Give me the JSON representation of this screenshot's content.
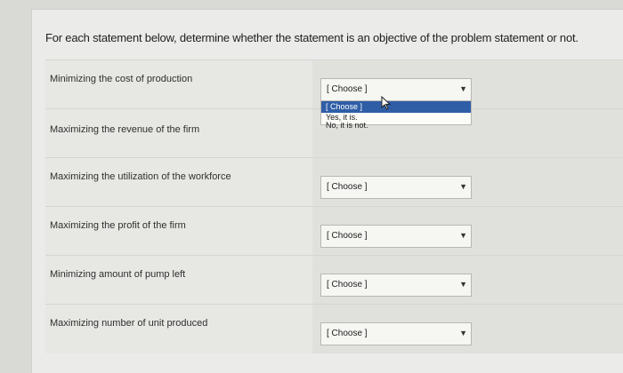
{
  "prompt": "For each statement below, determine whether the statement is an objective of the problem statement or not.",
  "rows": [
    {
      "statement": "Minimizing the cost of production",
      "select_value": "[ Choose ]"
    },
    {
      "statement": "Maximizing the revenue of the firm",
      "select_value": ""
    },
    {
      "statement": "Maximizing the utilization of the workforce",
      "select_value": "[ Choose ]"
    },
    {
      "statement": "Maximizing the profit of the firm",
      "select_value": "[ Choose ]"
    },
    {
      "statement": "Minimizing amount of pump left",
      "select_value": "[ Choose ]"
    },
    {
      "statement": "Maximizing number of unit produced",
      "select_value": "[ Choose ]"
    }
  ],
  "dropdown": {
    "options": [
      "[ Choose ]",
      "Yes, it is.",
      "No, it is not."
    ],
    "highlighted_option": "[ Choose ]"
  },
  "icons": {
    "chevron": "chevron-down-icon",
    "cursor": "mouse-pointer-icon"
  },
  "colors": {
    "highlight": "#2f5ea7",
    "background": "#ebebea"
  }
}
